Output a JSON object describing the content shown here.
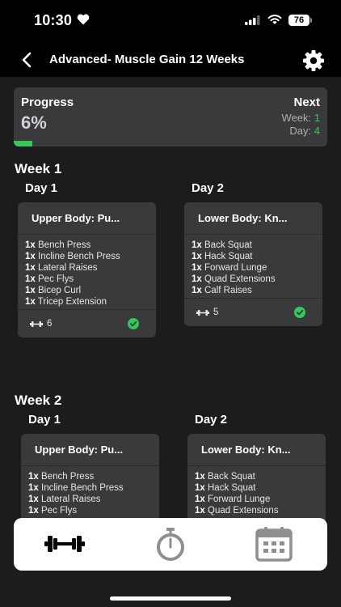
{
  "status": {
    "time": "10:30",
    "battery": "76"
  },
  "nav": {
    "title": "Advanced- Muscle Gain 12 Weeks"
  },
  "progress": {
    "label": "Progress",
    "value": "6%",
    "fraction": 0.06,
    "next_label": "Next",
    "week_label": "Week:",
    "week_value": "1",
    "day_label": "Day:",
    "day_value": "4"
  },
  "weeks": [
    {
      "title": "Week 1",
      "days": [
        {
          "title": "Day 1",
          "card_title": "Upper Body: Pu...",
          "exercises": [
            {
              "qty": "1x",
              "name": "Bench Press"
            },
            {
              "qty": "1x",
              "name": "Incline Bench Press"
            },
            {
              "qty": "1x",
              "name": "Lateral Raises"
            },
            {
              "qty": "1x",
              "name": "Pec Flys"
            },
            {
              "qty": "1x",
              "name": "Bicep Curl"
            },
            {
              "qty": "1x",
              "name": "Tricep Extension"
            }
          ],
          "count": "6",
          "completed": true
        },
        {
          "title": "Day 2",
          "card_title": "Lower Body: Kn...",
          "exercises": [
            {
              "qty": "1x",
              "name": "Back Squat"
            },
            {
              "qty": "1x",
              "name": "Hack Squat"
            },
            {
              "qty": "1x",
              "name": "Forward Lunge"
            },
            {
              "qty": "1x",
              "name": "Quad Extensions"
            },
            {
              "qty": "1x",
              "name": "Calf Raises"
            }
          ],
          "count": "5",
          "completed": true
        }
      ]
    },
    {
      "title": "Week 2",
      "days": [
        {
          "title": "Day 1",
          "card_title": "Upper Body: Pu...",
          "exercises": [
            {
              "qty": "1x",
              "name": "Bench Press"
            },
            {
              "qty": "1x",
              "name": "Incline Bench Press"
            },
            {
              "qty": "1x",
              "name": "Lateral Raises"
            },
            {
              "qty": "1x",
              "name": "Pec Flys"
            }
          ]
        },
        {
          "title": "Day 2",
          "card_title": "Lower Body: Kn...",
          "exercises": [
            {
              "qty": "1x",
              "name": "Back Squat"
            },
            {
              "qty": "1x",
              "name": "Hack Squat"
            },
            {
              "qty": "1x",
              "name": "Forward Lunge"
            },
            {
              "qty": "1x",
              "name": "Quad Extensions"
            }
          ]
        }
      ]
    }
  ],
  "tabs": [
    {
      "icon": "dumbbell-icon",
      "active": true
    },
    {
      "icon": "stopwatch-icon",
      "active": false
    },
    {
      "icon": "calendar-icon",
      "active": false
    }
  ],
  "colors": {
    "accent": "#34c759",
    "card": "#3a3a3c",
    "background": "#1c1c1e"
  }
}
